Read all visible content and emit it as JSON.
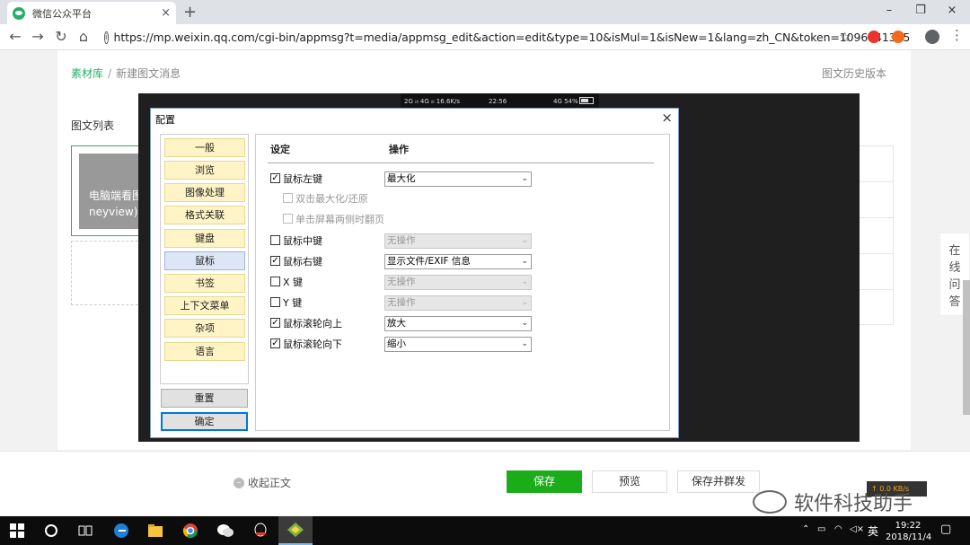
{
  "browser": {
    "tab_title": "微信公众平台",
    "tab_close": "×",
    "new_tab": "+",
    "win_min": "–",
    "win_max": "❐",
    "win_close": "×",
    "url": "https://mp.weixin.qq.com/cgi-bin/appmsg?t=media/appmsg_edit&action=edit&type=10&isMul=1&isNew=1&lang=zh_CN&token=1096741385",
    "info_icon": "i",
    "back": "←",
    "forward": "→",
    "reload": "↻",
    "home": "⌂",
    "star": "☆",
    "menu": "⋮"
  },
  "page": {
    "breadcrumb_lib": "素材库",
    "breadcrumb_sep": "/",
    "breadcrumb_current": "新建图文消息",
    "history": "图文历史版本",
    "list_title": "图文列表",
    "card_text_1": "电脑端看图",
    "card_text_2": "neyview)",
    "ask_online": [
      "在",
      "线",
      "问",
      "答"
    ]
  },
  "phone_status": {
    "signal": "2G ᵢₗₗ 4G ᵢₗₗ 16.6K/s",
    "time": "22:56",
    "battery": "4G 54%"
  },
  "dialog": {
    "title": "配置",
    "close": "×",
    "nav": [
      "一般",
      "浏览",
      "图像处理",
      "格式关联",
      "键盘",
      "鼠标",
      "书签",
      "上下文菜单",
      "杂项",
      "语言"
    ],
    "selected_index": 5,
    "reset": "重置",
    "ok": "确定",
    "col_setting": "设定",
    "col_action": "操作",
    "rows": {
      "left": {
        "label": "鼠标左键",
        "checked": true,
        "value": "最大化",
        "disabled": false
      },
      "double": {
        "label": "双击最大化/还原",
        "checked": false,
        "disabled": true
      },
      "single": {
        "label": "单击屏幕两侧时翻页",
        "checked": false,
        "disabled": true
      },
      "middle": {
        "label": "鼠标中键",
        "checked": false,
        "value": "无操作",
        "disabled": true
      },
      "right": {
        "label": "鼠标右键",
        "checked": true,
        "value": "显示文件/EXIF 信息",
        "disabled": false
      },
      "x": {
        "label": "X 键",
        "checked": false,
        "value": "无操作",
        "disabled": true
      },
      "y": {
        "label": "Y 键",
        "checked": false,
        "value": "无操作",
        "disabled": true
      },
      "wheel_up": {
        "label": "鼠标滚轮向上",
        "checked": true,
        "value": "放大",
        "disabled": false
      },
      "wheel_down": {
        "label": "鼠标滚轮向下",
        "checked": true,
        "value": "缩小",
        "disabled": false
      }
    },
    "check_mark": "✓",
    "arrow": "⌄"
  },
  "bottom": {
    "collapse": "收起正文",
    "save": "保存",
    "preview": "预览",
    "save_publish": "保存并群发",
    "speed": "↑ 0.0 KB/s",
    "watermark": "软件科技助手"
  },
  "taskbar": {
    "tray_lang": "英",
    "time": "19:22",
    "date": "2018/11/4"
  },
  "colors": {
    "accent": "#2aae67",
    "primary_button": "#1aad19",
    "nav_item": "#fff4c6",
    "nav_selected": "#dce6f5"
  }
}
